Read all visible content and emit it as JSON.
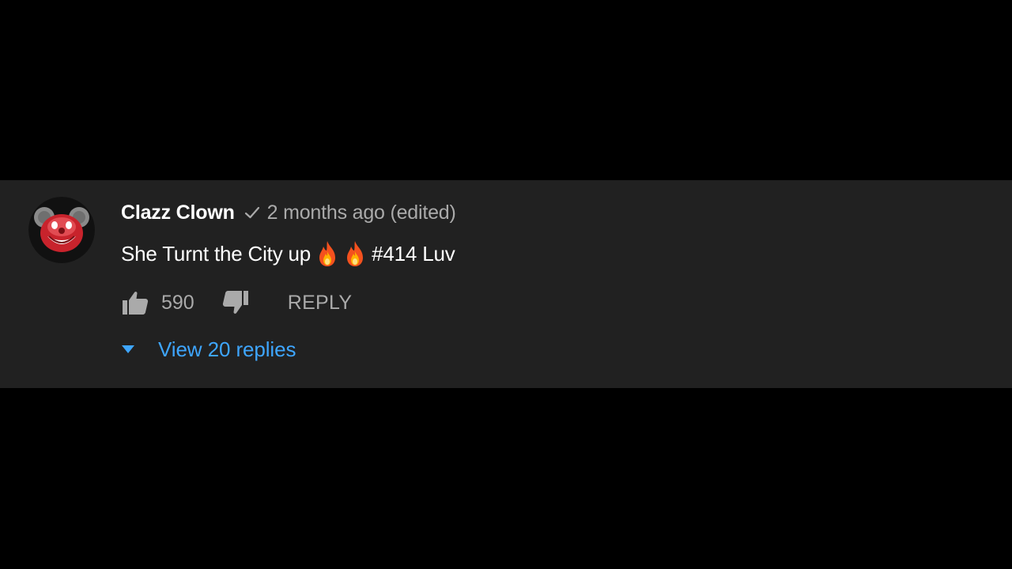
{
  "comment": {
    "author": "Clazz Clown",
    "timestamp": "2 months ago (edited)",
    "text_before": "She Turnt the City up ",
    "text_after": " #414 Luv",
    "emoji": [
      "fire",
      "fire"
    ],
    "like_count": "590",
    "reply_label": "REPLY",
    "view_replies_label": "View 20 replies"
  },
  "icons": {
    "verified": "checkmark-icon",
    "like": "thumbs-up-icon",
    "dislike": "thumbs-down-icon",
    "expand": "caret-down-icon"
  },
  "colors": {
    "background": "#000000",
    "card": "#212121",
    "primary_text": "#ffffff",
    "secondary_text": "#aaaaaa",
    "link": "#3ea6ff"
  }
}
